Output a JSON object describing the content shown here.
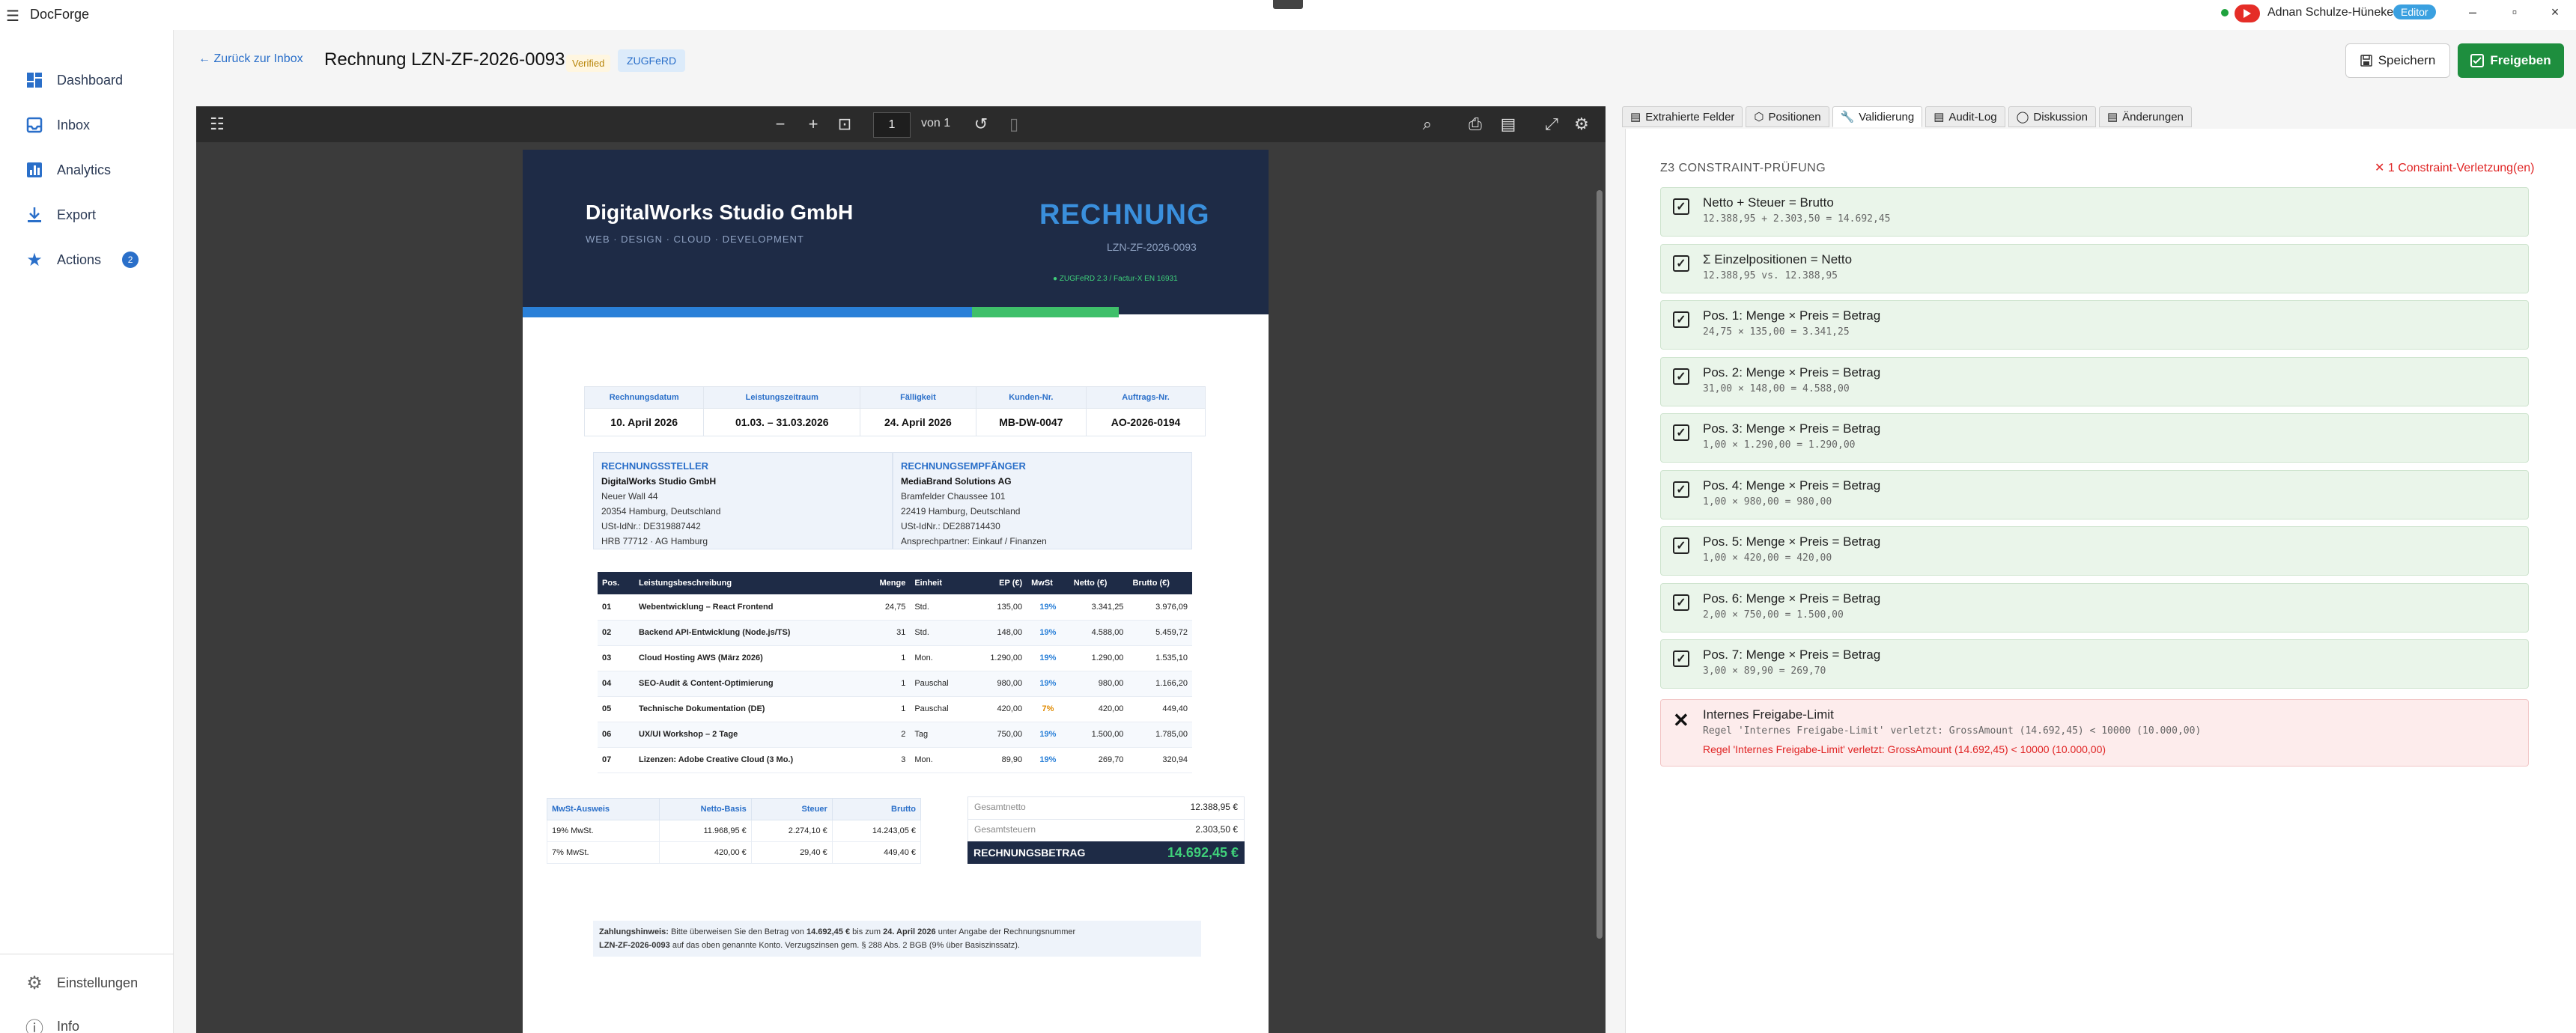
{
  "window": {
    "app_title": "DocForge",
    "user_name": "Adnan Schulze-Hüneke",
    "role": "Editor",
    "minimize": "–",
    "maximize": "▫",
    "close": "×"
  },
  "sidebar": {
    "items": [
      {
        "label": "Dashboard",
        "icon": "dashboard-icon"
      },
      {
        "label": "Inbox",
        "icon": "inbox-icon"
      },
      {
        "label": "Analytics",
        "icon": "analytics-icon"
      },
      {
        "label": "Export",
        "icon": "export-icon"
      },
      {
        "label": "Actions",
        "icon": "star-icon",
        "badge": "2"
      }
    ],
    "bottom_items": [
      {
        "label": "Einstellungen",
        "icon": "gear-icon"
      },
      {
        "label": "Info",
        "icon": "info-icon"
      }
    ]
  },
  "header": {
    "back_label": "← Zurück zur Inbox",
    "title": "Rechnung LZN-ZF-2026-0093",
    "verified": "Verified",
    "format_badge": "ZUGFeRD",
    "save_label": "Speichern",
    "approve_label": "Freigeben"
  },
  "pdf": {
    "page": "1",
    "page_of": "von 1"
  },
  "invoice": {
    "company": "DigitalWorks Studio GmbH",
    "tagline": "WEB · DESIGN · CLOUD · DEVELOPMENT",
    "doc_type": "RECHNUNG",
    "number": "LZN-ZF-2026-0093",
    "zugferd": "● ZUGFeRD 2.3 / Factur-X EN 16931",
    "meta_headers": [
      "Rechnungsdatum",
      "Leistungszeitraum",
      "Fälligkeit",
      "Kunden-Nr.",
      "Auftrags-Nr."
    ],
    "meta_values": [
      "10. April 2026",
      "01.03. – 31.03.2026",
      "24. April 2026",
      "MB-DW-0047",
      "AO-2026-0194"
    ],
    "seller": {
      "title": "RECHNUNGSSTELLER",
      "name": "DigitalWorks Studio GmbH",
      "lines": [
        "Neuer Wall 44",
        "20354 Hamburg, Deutschland",
        "USt-IdNr.: DE319887442",
        "HRB 77712 · AG Hamburg"
      ]
    },
    "buyer": {
      "title": "RECHNUNGSEMPFÄNGER",
      "name": "MediaBrand Solutions AG",
      "lines": [
        "Bramfelder Chaussee 101",
        "22419 Hamburg, Deutschland",
        "USt-IdNr.: DE288714430",
        "Ansprechpartner: Einkauf / Finanzen"
      ]
    },
    "items_headers": [
      "Pos.",
      "Leistungsbeschreibung",
      "Menge",
      "Einheit",
      "EP (€)",
      "MwSt",
      "Netto (€)",
      "Brutto (€)"
    ],
    "items": [
      [
        "01",
        "Webentwicklung – React Frontend",
        "24,75",
        "Std.",
        "135,00",
        "19%",
        "3.341,25",
        "3.976,09"
      ],
      [
        "02",
        "Backend API-Entwicklung (Node.js/TS)",
        "31",
        "Std.",
        "148,00",
        "19%",
        "4.588,00",
        "5.459,72"
      ],
      [
        "03",
        "Cloud Hosting AWS (März 2026)",
        "1",
        "Mon.",
        "1.290,00",
        "19%",
        "1.290,00",
        "1.535,10"
      ],
      [
        "04",
        "SEO-Audit & Content-Optimierung",
        "1",
        "Pauschal",
        "980,00",
        "19%",
        "980,00",
        "1.166,20"
      ],
      [
        "05",
        "Technische Dokumentation (DE)",
        "1",
        "Pauschal",
        "420,00",
        "7%",
        "420,00",
        "449,40"
      ],
      [
        "06",
        "UX/UI Workshop – 2 Tage",
        "2",
        "Tag",
        "750,00",
        "19%",
        "1.500,00",
        "1.785,00"
      ],
      [
        "07",
        "Lizenzen: Adobe Creative Cloud (3 Mo.)",
        "3",
        "Mon.",
        "89,90",
        "19%",
        "269,70",
        "320,94"
      ]
    ],
    "vat_headers": [
      "MwSt-Ausweis",
      "Netto-Basis",
      "Steuer",
      "Brutto"
    ],
    "vat_rows": [
      [
        "19% MwSt.",
        "11.968,95 €",
        "2.274,10 €",
        "14.243,05 €"
      ],
      [
        "7% MwSt.",
        "420,00 €",
        "29,40 €",
        "449,40 €"
      ]
    ],
    "sum_net_label": "Gesamtnetto",
    "sum_net": "12.388,95 €",
    "sum_tax_label": "Gesamtsteuern",
    "sum_tax": "2.303,50 €",
    "total_label": "RECHNUNGSBETRAG",
    "total": "14.692,45 €",
    "payment_prefix": "Zahlungshinweis:",
    "payment_text_1": " Bitte überweisen Sie den Betrag von ",
    "payment_amount": "14.692,45 €",
    "payment_text_2": " bis zum ",
    "payment_date": "24. April 2026",
    "payment_text_3": " unter Angabe der Rechnungsnummer",
    "payment_number": "LZN-ZF-2026-0093",
    "payment_text_4": " auf das oben genannte Konto. Verzugszinsen gem. § 288 Abs. 2 BGB (9% über Basiszinssatz)."
  },
  "tabs": [
    {
      "label": "Extrahierte Felder",
      "icon": "fields-icon",
      "glyph": "▤"
    },
    {
      "label": "Positionen",
      "icon": "box-icon",
      "glyph": "⬡"
    },
    {
      "label": "Validierung",
      "icon": "wrench-icon",
      "glyph": "🔧"
    },
    {
      "label": "Audit-Log",
      "icon": "log-icon",
      "glyph": "▤"
    },
    {
      "label": "Diskussion",
      "icon": "chat-icon",
      "glyph": "◯"
    },
    {
      "label": "Änderungen",
      "icon": "changes-icon",
      "glyph": "▤"
    }
  ],
  "validation": {
    "heading": "Z3 CONSTRAINT-PRÜFUNG",
    "violation_summary": "✕ 1 Constraint-Verletzung(en)",
    "checks": [
      {
        "title": "Netto + Steuer = Brutto",
        "detail": "12.388,95 + 2.303,50 = 14.692,45",
        "status": "pass"
      },
      {
        "title": "Σ Einzelpositionen = Netto",
        "detail": "12.388,95 vs. 12.388,95",
        "status": "pass"
      },
      {
        "title": "Pos. 1: Menge × Preis = Betrag",
        "detail": "24,75 × 135,00 = 3.341,25",
        "status": "pass"
      },
      {
        "title": "Pos. 2: Menge × Preis = Betrag",
        "detail": "31,00 × 148,00 = 4.588,00",
        "status": "pass"
      },
      {
        "title": "Pos. 3: Menge × Preis = Betrag",
        "detail": "1,00 × 1.290,00 = 1.290,00",
        "status": "pass"
      },
      {
        "title": "Pos. 4: Menge × Preis = Betrag",
        "detail": "1,00 × 980,00 = 980,00",
        "status": "pass"
      },
      {
        "title": "Pos. 5: Menge × Preis = Betrag",
        "detail": "1,00 × 420,00 = 420,00",
        "status": "pass"
      },
      {
        "title": "Pos. 6: Menge × Preis = Betrag",
        "detail": "2,00 × 750,00 = 1.500,00",
        "status": "pass"
      },
      {
        "title": "Pos. 7: Menge × Preis = Betrag",
        "detail": "3,00 × 89,90 = 269,70",
        "status": "pass"
      }
    ],
    "fail_check": {
      "title": "Internes Freigabe-Limit",
      "detail": "Regel 'Internes Freigabe-Limit' verletzt: GrossAmount (14.692,45) < 10000 (10.000,00)",
      "error": "Regel 'Internes Freigabe-Limit' verletzt: GrossAmount (14.692,45) < 10000 (10.000,00)"
    }
  },
  "colors": {
    "accent": "#2a6fc9",
    "approve": "#1e8e3e",
    "pass_bg": "#eaf5ea",
    "fail_bg": "#fdecec",
    "error": "#e02424",
    "invoice_header": "#1e2b46"
  }
}
